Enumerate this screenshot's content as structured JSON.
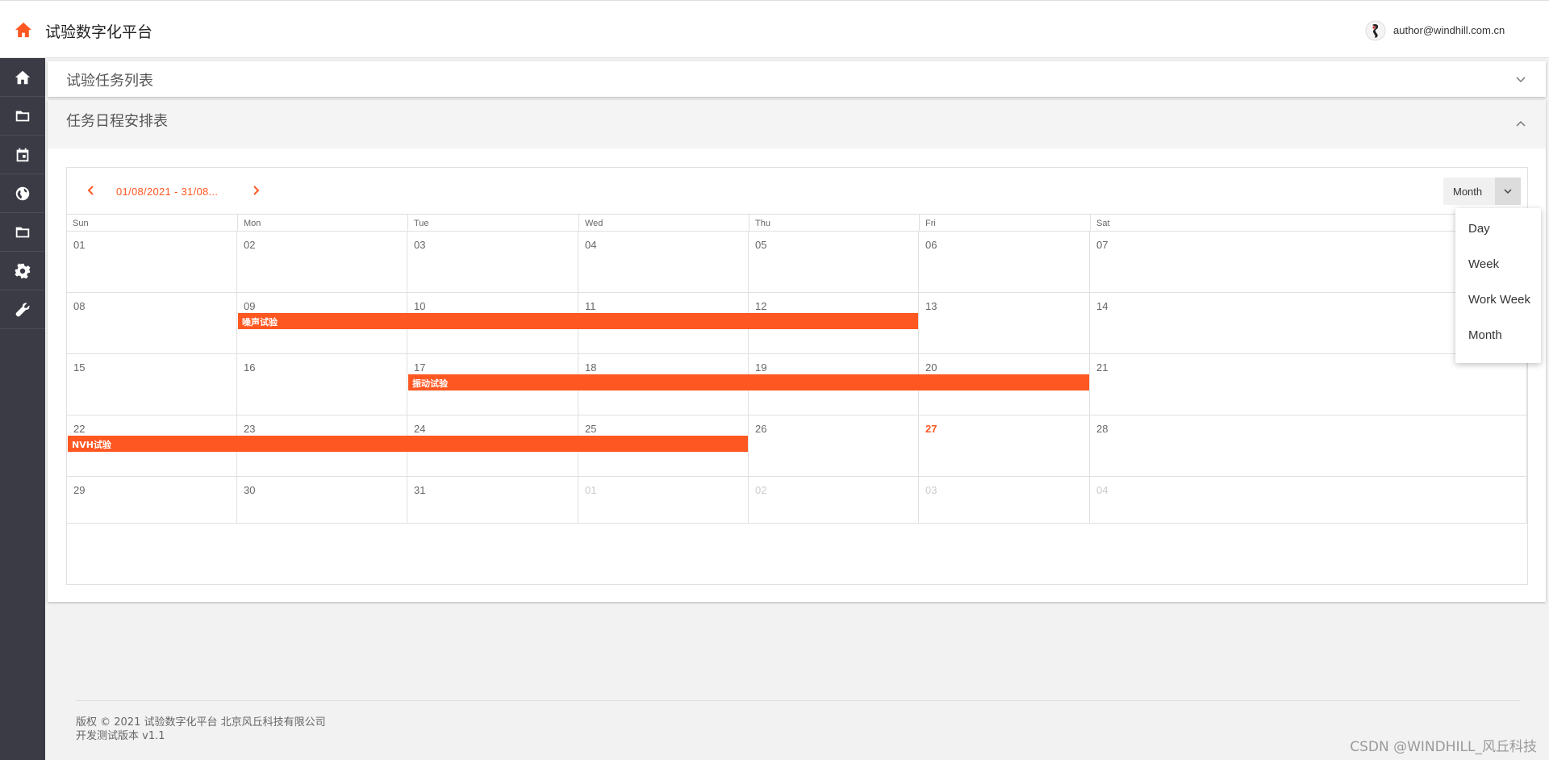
{
  "header": {
    "title": "试验数字化平台",
    "user_email": "author@windhill.com.cn"
  },
  "sidebar": {
    "items": [
      "home-icon",
      "folder-icon",
      "calendar-icon",
      "globe-icon",
      "folder-icon",
      "gear-icon",
      "wrench-icon"
    ]
  },
  "panels": {
    "task_list_title": "试验任务列表",
    "schedule_title": "任务日程安排表"
  },
  "scheduler": {
    "date_range": "01/08/2021 - 31/08...",
    "view_label": "Month",
    "weekdays": [
      "Sun",
      "Mon",
      "Tue",
      "Wed",
      "Thu",
      "Fri",
      "Sat"
    ],
    "weeks": [
      [
        "01",
        "02",
        "03",
        "04",
        "05",
        "06",
        "07"
      ],
      [
        "08",
        "09",
        "10",
        "11",
        "12",
        "13",
        "14"
      ],
      [
        "15",
        "16",
        "17",
        "18",
        "19",
        "20",
        "21"
      ],
      [
        "22",
        "23",
        "24",
        "25",
        "26",
        "27",
        "28"
      ],
      [
        "29",
        "30",
        "31",
        "01",
        "02",
        "03",
        "04"
      ]
    ],
    "today": "27",
    "events": [
      {
        "title": "噪声试验",
        "start": "09",
        "end": "13"
      },
      {
        "title": "振动试验",
        "start": "17",
        "end": "21"
      },
      {
        "title": "NVH试验",
        "start": "22",
        "end": "26"
      }
    ],
    "view_options": [
      "Day",
      "Week",
      "Work Week",
      "Month"
    ]
  },
  "footer": {
    "copyright": "版权 © 2021 试验数字化平台 北京风丘科技有限公司",
    "version": "开发测试版本 v1.1"
  },
  "watermark": "CSDN @WINDHILL_风丘科技",
  "colors": {
    "accent": "#ff5722",
    "sidebar": "#3a3b45"
  }
}
